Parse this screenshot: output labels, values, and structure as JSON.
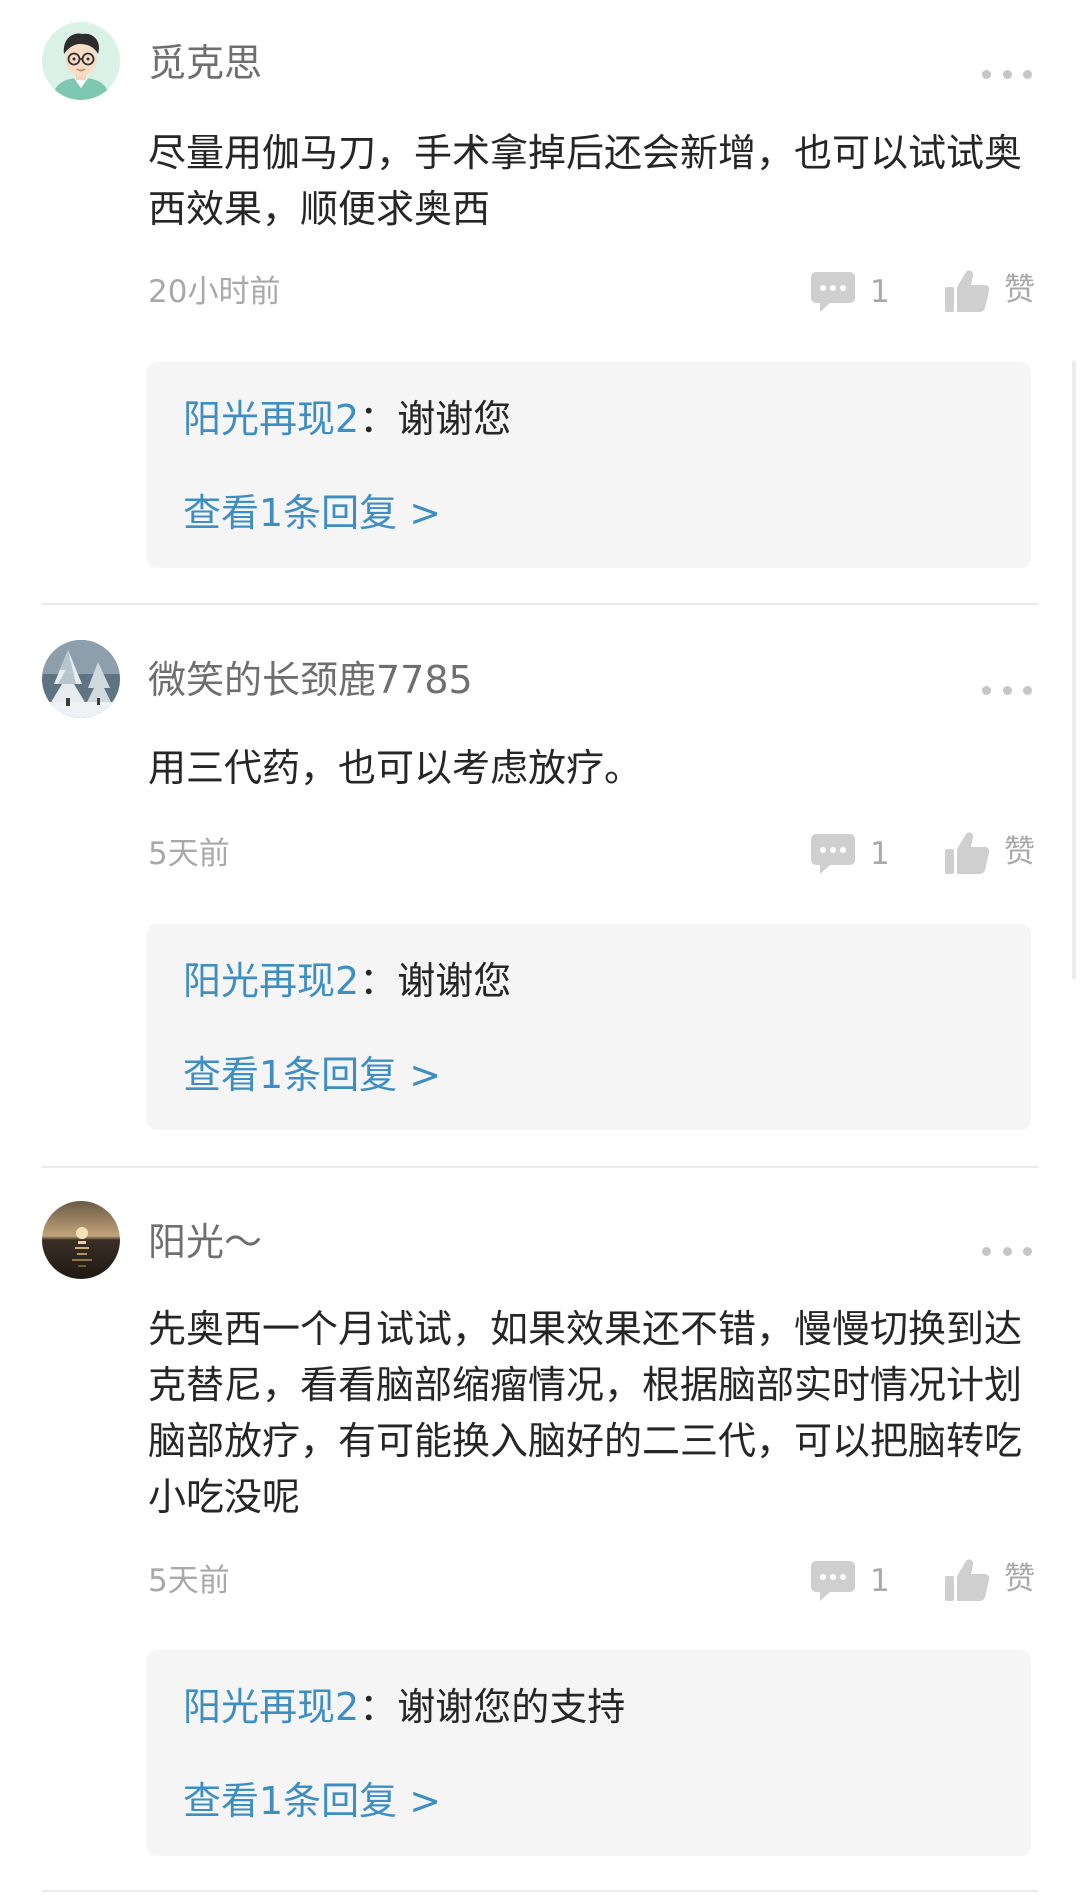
{
  "comments": [
    {
      "username": "觅克思",
      "avatar_icon": "cartoon-avatar-with-glasses",
      "text": "尽量用伽马刀，手术拿掉后还会新增，也可以试试奥西效果，顺便求奥西",
      "time": "20小时前",
      "reply_count": "1",
      "like_label": "赞",
      "reply": {
        "author": "阳光再现2",
        "separator": "：",
        "content": "谢谢您"
      },
      "view_replies": "查看1条回复 >"
    },
    {
      "username": "微笑的长颈鹿7785",
      "avatar_icon": "snowy-tree-photo-avatar",
      "text": "用三代药，也可以考虑放疗。",
      "time": "5天前",
      "reply_count": "1",
      "like_label": "赞",
      "reply": {
        "author": "阳光再现2",
        "separator": "：",
        "content": "谢谢您"
      },
      "view_replies": "查看1条回复 >"
    },
    {
      "username": "阳光～",
      "avatar_icon": "sunset-sea-photo-avatar",
      "text": "先奥西一个月试试，如果效果还不错，慢慢切换到达克替尼，看看脑部缩瘤情况，根据脑部实时情况计划脑部放疗，有可能换入脑好的二三代，可以把脑转吃小吃没呢",
      "time": "5天前",
      "reply_count": "1",
      "like_label": "赞",
      "reply": {
        "author": "阳光再现2",
        "separator": "：",
        "content": "谢谢您的支持"
      },
      "view_replies": "查看1条回复 >"
    }
  ],
  "colors": {
    "link_blue": "#3e8ec2",
    "reply_bg": "#f5f5f5",
    "muted_gray": "#a9a9a9",
    "icon_gray": "#cfcfcf"
  }
}
